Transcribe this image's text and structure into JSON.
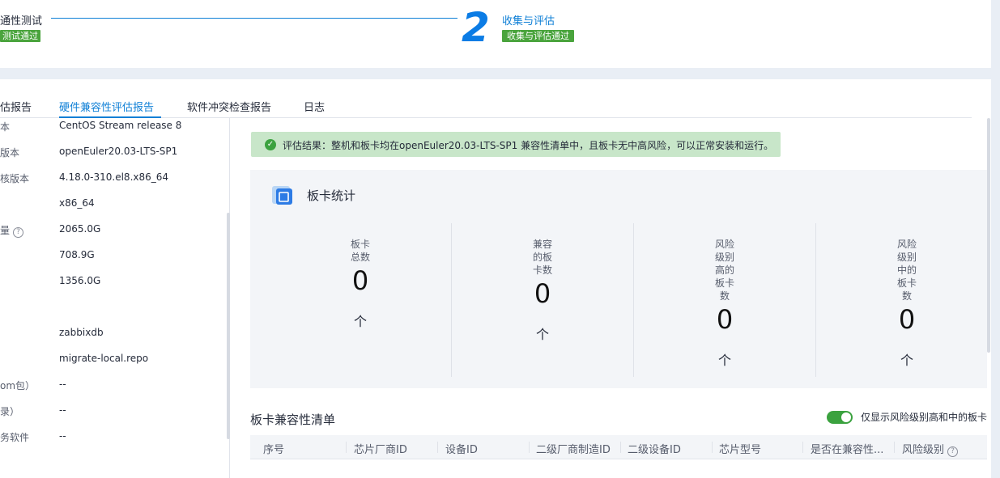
{
  "stepper": {
    "step1": {
      "title": "通性测试",
      "badge": "测试通过"
    },
    "step2": {
      "number": "2",
      "title": "收集与评估",
      "badge": "收集与评估通过"
    }
  },
  "tabs": [
    {
      "label": "估报告"
    },
    {
      "label": "硬件兼容性评估报告",
      "active": true
    },
    {
      "label": "软件冲突检查报告"
    },
    {
      "label": "日志"
    }
  ],
  "info": [
    {
      "label": "本",
      "value": "CentOS Stream release 8"
    },
    {
      "label": "版本",
      "value": "openEuler20.03-LTS-SP1"
    },
    {
      "label": "核版本",
      "value": "4.18.0-310.el8.x86_64"
    },
    {
      "label": "",
      "value": "x86_64"
    },
    {
      "label": "量",
      "value": "2065.0G",
      "help": "?"
    },
    {
      "label": "",
      "value": "708.9G"
    },
    {
      "label": "",
      "value": "1356.0G"
    },
    {
      "label": "",
      "value": ""
    },
    {
      "label": "",
      "value": "zabbixdb"
    },
    {
      "label": "",
      "value": "migrate-local.repo"
    },
    {
      "label": "om包）",
      "value": "--"
    },
    {
      "label": "录）",
      "value": "--"
    },
    {
      "label": "务软件",
      "value": "--"
    }
  ],
  "alert": {
    "icon": "check-circle-icon",
    "text": "评估结果：整机和板卡均在openEuler20.03-LTS-SP1 兼容性清单中，且板卡无中高风险，可以正常安装和运行。"
  },
  "stats": {
    "title": "板卡统计",
    "items": [
      {
        "label_lines": [
          "板卡",
          "总数"
        ],
        "value": "0",
        "unit": "个"
      },
      {
        "label_lines": [
          "兼容",
          "的板",
          "卡数"
        ],
        "value": "0",
        "unit": "个"
      },
      {
        "label_lines": [
          "风险",
          "级别",
          "高的",
          "板卡",
          "数"
        ],
        "value": "0",
        "unit": "个"
      },
      {
        "label_lines": [
          "风险",
          "级别",
          "中的",
          "板卡",
          "数"
        ],
        "value": "0",
        "unit": "个"
      }
    ]
  },
  "list": {
    "title": "板卡兼容性清单",
    "toggle_label": "仅显示风险级别高和中的板卡",
    "toggle_on": true,
    "columns": [
      "序号",
      "芯片厂商ID",
      "设备ID",
      "二级厂商制造ID",
      "二级设备ID",
      "芯片型号",
      "是否在兼容性...",
      "风险级别"
    ]
  },
  "colors": {
    "accent": "#0e7fd6",
    "success": "#4aa43d",
    "alert_bg": "#c8e6c9"
  }
}
